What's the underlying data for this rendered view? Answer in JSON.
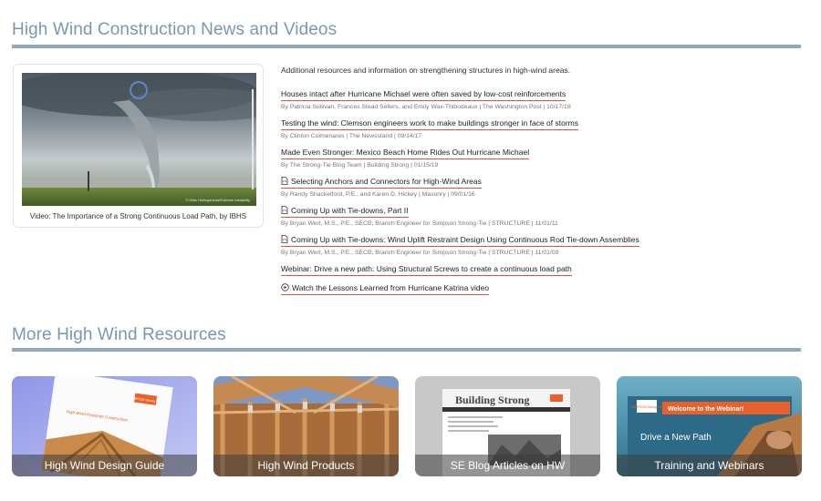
{
  "sections": {
    "news_title": "High Wind Construction News and Videos",
    "resources_title": "More High Wind Resources"
  },
  "video": {
    "caption": "Video: The Importance of a Strong Continuous Load Path, by IBHS",
    "thumb_credit": "© Mike Hollingshead/Extreme Instability"
  },
  "intro": "Additional resources and information on strengthening structures in high-wind areas.",
  "articles": [
    {
      "title": "Houses intact after Hurricane Michael were often saved by low-cost reinforcements",
      "meta": "By Patricia Sullivan, Frances Stead Sellers, and Emily Wax-Thibodeaux | The Washington Post | 10/17/18",
      "icon": ""
    },
    {
      "title": "Testing the wind: Clemson engineers work to make buildings stronger in face of storms",
      "meta": "By Clinton Colmenares | The Newsstand | 09/14/17",
      "icon": ""
    },
    {
      "title": "Made Even Stronger: Mexico Beach Home Rides Out Hurricane Michael",
      "meta": "By The Strong-Tie Blog Team | Building Strong | 01/15/19",
      "icon": ""
    },
    {
      "title": "Selecting Anchors and Connectors for High-Wind Areas",
      "meta": "By Randy Shackelford, P.E., and Karen D. Hickey | Masonry | 09/01/16",
      "icon": "pdf-icon"
    },
    {
      "title": "Coming Up with Tie-downs, Part II",
      "meta": "By Bryan Wert, M.S., P.E., SECB, Branch Engineer for Simpson Strong-Tie | STRUCTURE | 11/01/11",
      "icon": "pdf-icon"
    },
    {
      "title": "Coming Up with Tie-downs: Wind Uplift Restraint Design Using Continuous Rod Tie-down Assemblies",
      "meta": "By Bryan Wert, M.S., P.E., SECB, Branch Engineer for Simpson Strong-Tie | STRUCTURE | 11/01/09",
      "icon": "pdf-icon"
    },
    {
      "title": "Webinar: Drive a new path: Using Structural Screws to create a continuous load path",
      "meta": "",
      "icon": ""
    },
    {
      "title": "Watch the Lessons Learned from Hurricane Katrina video",
      "meta": "",
      "icon": "play-icon"
    }
  ],
  "tiles": [
    {
      "label": "High Wind Design Guide",
      "thumb_text": "High-Wind-Resistant Construction",
      "brand": "SIMPSON Strong-Tie"
    },
    {
      "label": "High Wind Products"
    },
    {
      "label": "SE Blog Articles on HW",
      "thumb_text": "Building Strong"
    },
    {
      "label": "Training and Webinars",
      "thumb_text": "Welcome to the Webinar!",
      "thumb_text2": "Drive a New Path",
      "brand": "SIMPSON Strong-Tie"
    }
  ],
  "colors": {
    "title": "#7a97b3",
    "rule": "#8ea8c0",
    "link_underline": "#d9534f",
    "brand_orange": "#e8612c"
  }
}
